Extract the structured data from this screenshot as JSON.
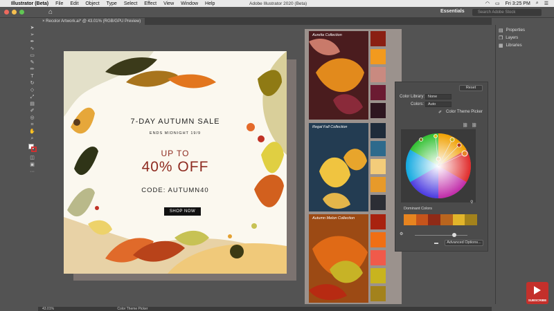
{
  "menubar": {
    "app_name": "Illustrator (Beta)",
    "items": [
      "File",
      "Edit",
      "Object",
      "Type",
      "Select",
      "Effect",
      "View",
      "Window",
      "Help"
    ],
    "window_title": "Adobe Illustrator 2020 (Beta)",
    "time": "Fri 3:25 PM"
  },
  "appbar": {
    "workspace": "Essentials",
    "search_placeholder": "Search Adobe Stock"
  },
  "document": {
    "tab_title": "Recolor Artwork.ai* @ 43.01% (RGB/GPU Preview)"
  },
  "artwork": {
    "title": "7-DAY AUTUMN SALE",
    "subtitle": "ENDS MIDNIGHT 19/9",
    "up_to": "UP TO",
    "offer": "40% OFF",
    "code": "CODE: AUTUMN40",
    "button": "SHOP NOW"
  },
  "collections": [
    {
      "name": "Aurelia Collection",
      "swatches": [
        "#8a1f12",
        "#f29a1e",
        "#c98a80",
        "#6b1b32",
        "#2e1620"
      ]
    },
    {
      "name": "Regal Fall Collection",
      "swatches": [
        "#1e2b3a",
        "#2e6a8c",
        "#f3cc7a",
        "#e79a2a",
        "#2c2e35"
      ]
    },
    {
      "name": "Autumn Melon Collection",
      "swatches": [
        "#a8220f",
        "#f06f14",
        "#f05a4a",
        "#c8b41e",
        "#a3821c"
      ]
    }
  ],
  "recolor_panel": {
    "reset": "Reset",
    "color_library_label": "Color Library:",
    "color_library_value": "None",
    "colors_label": "Colors:",
    "colors_value": "Auto",
    "theme_picker": "Color Theme Picker",
    "dominant_label": "Dominant Colors",
    "dominant_colors": [
      "#e7841f",
      "#c6541b",
      "#8f2a17",
      "#b9651e",
      "#e2b52a",
      "#a3821c"
    ],
    "advanced_button": "Advanced Options..."
  },
  "dock": {
    "properties": "Properties",
    "layers": "Layers",
    "libraries": "Libraries"
  },
  "status": {
    "zoom": "43.01%",
    "tool": "Color Theme Picker"
  },
  "youtube": {
    "label": "SUBSCRIBE"
  }
}
